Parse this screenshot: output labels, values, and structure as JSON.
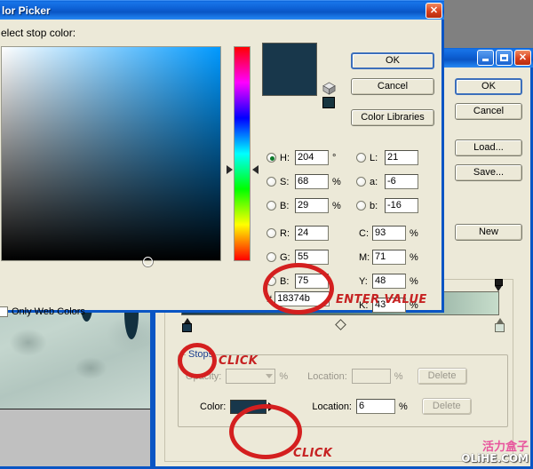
{
  "color_picker": {
    "title": "lor Picker",
    "subtitle": "elect stop color:",
    "buttons": {
      "ok": "OK",
      "cancel": "Cancel",
      "libraries": "Color Libraries"
    },
    "preview_color": "#18374b",
    "hue_degrees": 204,
    "channels": {
      "hsb": [
        {
          "name": "H",
          "label": "H:",
          "value": "204",
          "unit": "°",
          "selected": true
        },
        {
          "name": "S",
          "label": "S:",
          "value": "68",
          "unit": "%",
          "selected": false
        },
        {
          "name": "B",
          "label": "B:",
          "value": "29",
          "unit": "%",
          "selected": false
        }
      ],
      "rgb": [
        {
          "name": "R",
          "label": "R:",
          "value": "24",
          "unit": "",
          "selected": false
        },
        {
          "name": "G",
          "label": "G:",
          "value": "55",
          "unit": "",
          "selected": false
        },
        {
          "name": "B2",
          "label": "B:",
          "value": "75",
          "unit": "",
          "selected": false
        }
      ],
      "lab": [
        {
          "name": "L",
          "label": "L:",
          "value": "21",
          "unit": "",
          "selected": false
        },
        {
          "name": "a",
          "label": "a:",
          "value": "-6",
          "unit": "",
          "selected": false
        },
        {
          "name": "b",
          "label": "b:",
          "value": "-16",
          "unit": "",
          "selected": false
        }
      ],
      "cmyk": [
        {
          "name": "C",
          "label": "C:",
          "value": "93",
          "unit": "%"
        },
        {
          "name": "M",
          "label": "M:",
          "value": "71",
          "unit": "%"
        },
        {
          "name": "Y",
          "label": "Y:",
          "value": "48",
          "unit": "%"
        },
        {
          "name": "K",
          "label": "K:",
          "value": "43",
          "unit": "%"
        }
      ]
    },
    "hex": {
      "prefix": "#",
      "value": "18374b"
    },
    "only_web_colors": {
      "label": "Only Web Colors",
      "checked": false
    },
    "close_button": "✕",
    "cube_icon": "web-safe-cube-icon"
  },
  "gradient_editor": {
    "buttons": {
      "ok": "OK",
      "cancel": "Cancel",
      "load": "Load...",
      "save": "Save...",
      "new": "New"
    },
    "titlebar_buttons": {
      "minimize": "minimize-icon",
      "maximize": "maximize-icon",
      "close": "✕"
    },
    "gradient": {
      "start_color": "#18374b",
      "mid_color": "#5d7f76",
      "end_color": "#c7ddcb",
      "midpoint_percent": 50,
      "color_stops": [
        {
          "position": 0,
          "color": "#18374b",
          "selected": true
        },
        {
          "position": 100,
          "color": "#c7ddcb",
          "selected": false
        }
      ],
      "opacity_stops": [
        {
          "position": 0,
          "opacity": 100
        },
        {
          "position": 100,
          "opacity": 100
        }
      ]
    },
    "stops": {
      "legend": "Stops",
      "opacity_label": "Opacity:",
      "opacity_value": "",
      "opacity_unit": "%",
      "opacity_location_label": "Location:",
      "opacity_location_value": "",
      "opacity_location_unit": "%",
      "opacity_delete": "Delete",
      "color_label": "Color:",
      "color_value": "#18374b",
      "color_location_label": "Location:",
      "color_location_value": "6",
      "color_location_unit": "%",
      "color_delete": "Delete"
    }
  },
  "annotations": [
    {
      "name": "enter-value",
      "text": "ENTER VALUE"
    },
    {
      "name": "click-color-stop",
      "text": "CLICK"
    },
    {
      "name": "click-color-swatch",
      "text": "CLICK"
    }
  ],
  "watermark": {
    "cn": "活力盒子",
    "en": "OLiHE.COM"
  }
}
